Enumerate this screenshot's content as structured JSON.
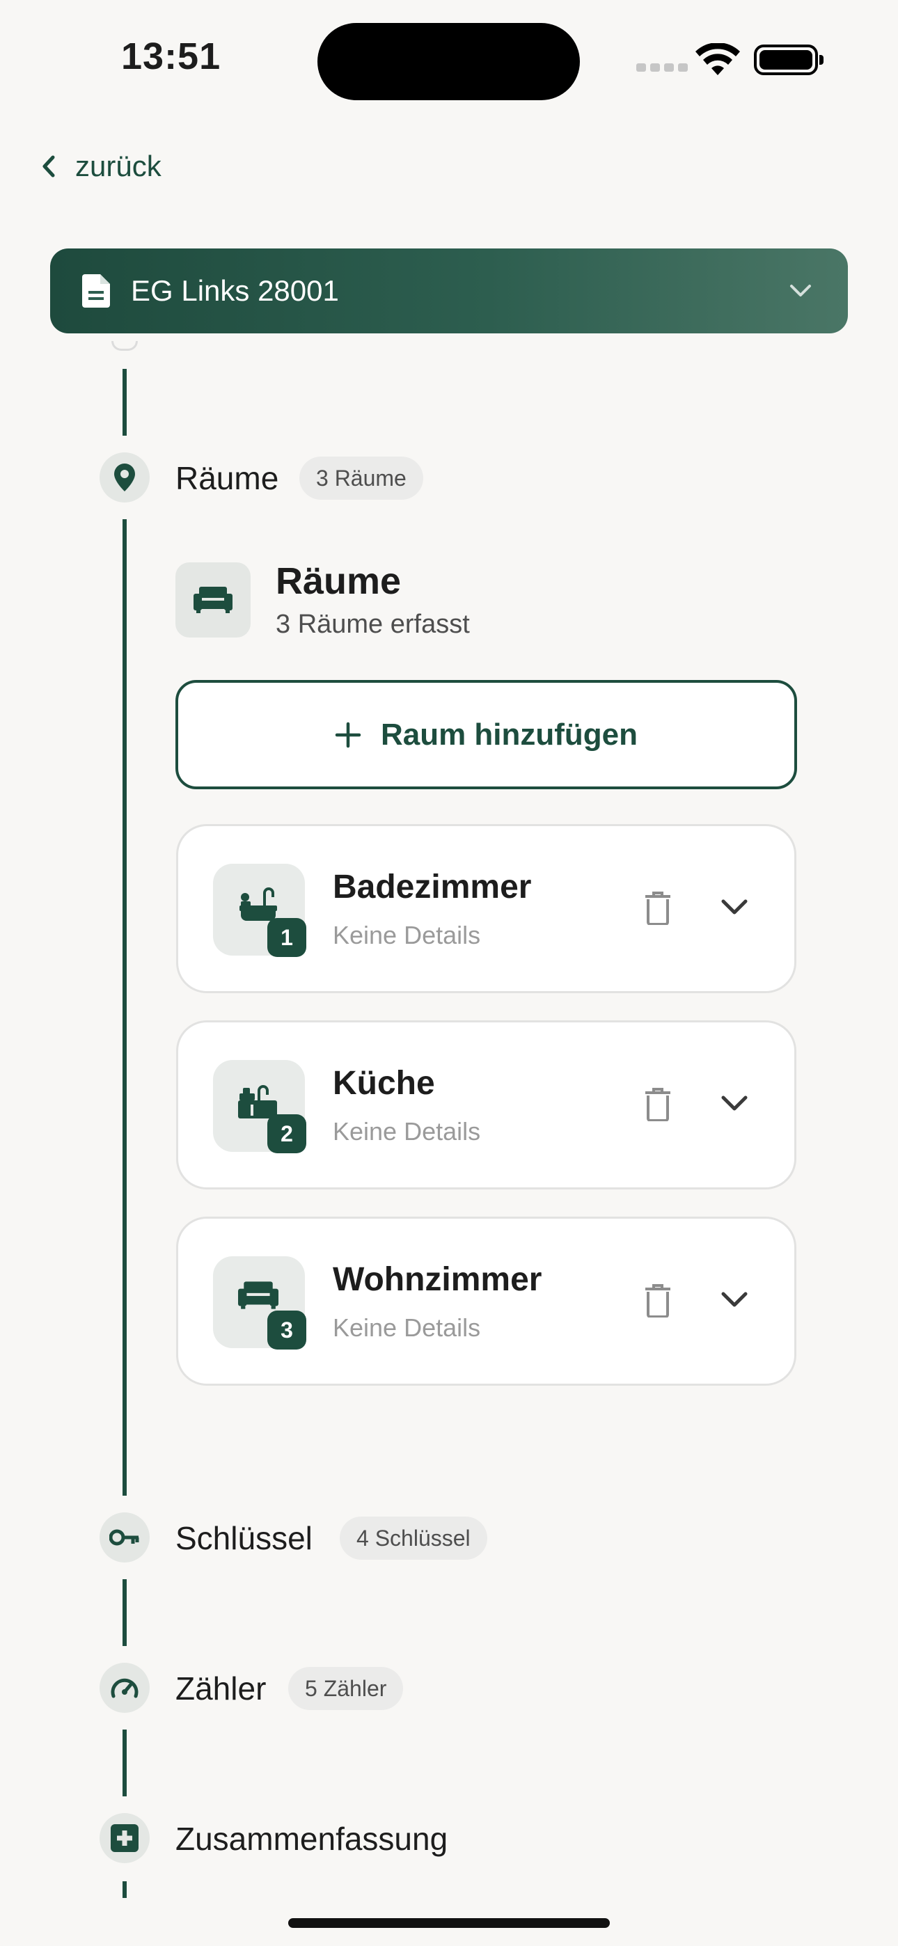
{
  "status_bar": {
    "time": "13:51"
  },
  "nav": {
    "back_label": "zurück"
  },
  "header": {
    "title": "EG Links 28001",
    "doc_icon": "document-icon",
    "expand_icon": "chevron-down-icon"
  },
  "steps": [
    {
      "label": "Räume",
      "badge": "3 Räume",
      "icon": "location-pin-icon"
    },
    {
      "label": "Schlüssel",
      "badge": "4 Schlüssel",
      "icon": "key-icon"
    },
    {
      "label": "Zähler",
      "badge": "5 Zähler",
      "icon": "gauge-icon"
    },
    {
      "label": "Zusammenfassung",
      "badge": "",
      "icon": "medical-plus-icon"
    }
  ],
  "rooms_section": {
    "title": "Räume",
    "subtitle": "3 Räume erfasst",
    "add_button": "Raum hinzufügen",
    "rooms": [
      {
        "name": "Badezimmer",
        "detail": "Keine Details",
        "number": "1",
        "icon": "bathtub-icon"
      },
      {
        "name": "Küche",
        "detail": "Keine Details",
        "number": "2",
        "icon": "kitchen-sink-icon"
      },
      {
        "name": "Wohnzimmer",
        "detail": "Keine Details",
        "number": "3",
        "icon": "sofa-icon"
      }
    ]
  },
  "colors": {
    "accent": "#1d4d3e",
    "background": "#f8f7f5"
  }
}
